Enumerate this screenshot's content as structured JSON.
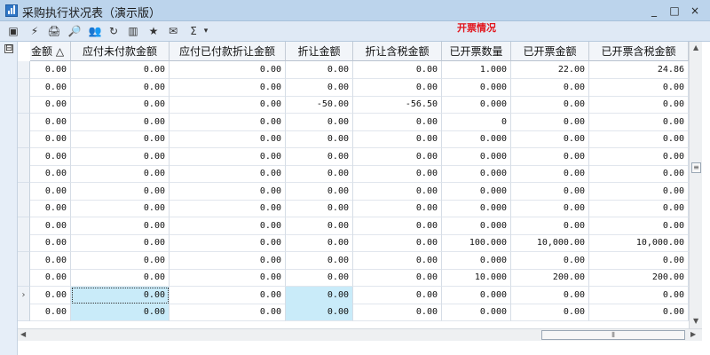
{
  "window": {
    "title": "采购执行状况表（演示版）",
    "minimize": "_",
    "maximize": "□",
    "close": "×"
  },
  "toolbar": [
    "▣",
    "⚡",
    "🖨",
    "🔎",
    "👥",
    "↻",
    "▥",
    "★",
    "✉",
    "Σ",
    "▾"
  ],
  "annotation": "开票情况",
  "columns": [
    "金额 △",
    "应付未付款金额",
    "应付已付款折让金额",
    "折让金额",
    "折让含税金额",
    "已开票数量",
    "已开票金额",
    "已开票含税金额"
  ],
  "rows": [
    [
      "0.00",
      "0.00",
      "0.00",
      "0.00",
      "0.00",
      "1.000",
      "22.00",
      "24.86"
    ],
    [
      "0.00",
      "0.00",
      "0.00",
      "0.00",
      "0.00",
      "0.000",
      "0.00",
      "0.00"
    ],
    [
      "0.00",
      "0.00",
      "0.00",
      "-50.00",
      "-56.50",
      "0.000",
      "0.00",
      "0.00"
    ],
    [
      "0.00",
      "0.00",
      "0.00",
      "0.00",
      "0.00",
      "0",
      "0.00",
      "0.00"
    ],
    [
      "0.00",
      "0.00",
      "0.00",
      "0.00",
      "0.00",
      "0.000",
      "0.00",
      "0.00"
    ],
    [
      "0.00",
      "0.00",
      "0.00",
      "0.00",
      "0.00",
      "0.000",
      "0.00",
      "0.00"
    ],
    [
      "0.00",
      "0.00",
      "0.00",
      "0.00",
      "0.00",
      "0.000",
      "0.00",
      "0.00"
    ],
    [
      "0.00",
      "0.00",
      "0.00",
      "0.00",
      "0.00",
      "0.000",
      "0.00",
      "0.00"
    ],
    [
      "0.00",
      "0.00",
      "0.00",
      "0.00",
      "0.00",
      "0.000",
      "0.00",
      "0.00"
    ],
    [
      "0.00",
      "0.00",
      "0.00",
      "0.00",
      "0.00",
      "0.000",
      "0.00",
      "0.00"
    ],
    [
      "0.00",
      "0.00",
      "0.00",
      "0.00",
      "0.00",
      "100.000",
      "10,000.00",
      "10,000.00"
    ],
    [
      "0.00",
      "0.00",
      "0.00",
      "0.00",
      "0.00",
      "0.000",
      "0.00",
      "0.00"
    ],
    [
      "0.00",
      "0.00",
      "0.00",
      "0.00",
      "0.00",
      "10.000",
      "200.00",
      "200.00"
    ],
    [
      "0.00",
      "0.00",
      "0.00",
      "0.00",
      "0.00",
      "0.000",
      "0.00",
      "0.00"
    ],
    [
      "0.00",
      "0.00",
      "0.00",
      "0.00",
      "0.00",
      "0.000",
      "0.00",
      "0.00"
    ]
  ],
  "current_row_marker": "›",
  "grid_control": "⊟",
  "scroll": {
    "up": "▲",
    "down": "▼",
    "left": "◀",
    "right": "▶",
    "grip": "≡",
    "hgrip": "⦀"
  }
}
